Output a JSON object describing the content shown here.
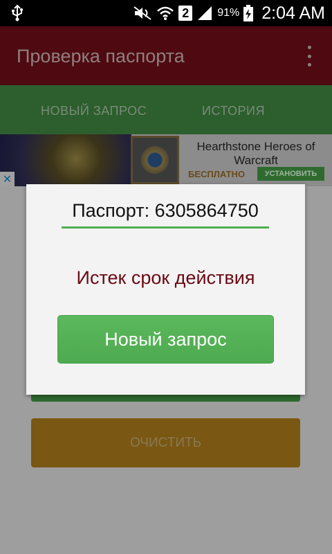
{
  "status_bar": {
    "battery_percent": "91%",
    "sim_slot": "2",
    "time": "2:04 AM"
  },
  "app_bar": {
    "title": "Проверка паспорта"
  },
  "tabs": [
    {
      "label": "НОВЫЙ ЗАПРОС"
    },
    {
      "label": "ИСТОРИЯ"
    }
  ],
  "ad": {
    "title": "Hearthstone Heroes of Warcraft",
    "price": "БЕСПЛАТНО",
    "install_label": "УСТАНОВИТЬ",
    "close_symbol": "✕"
  },
  "background_buttons": {
    "clear_label": "ОЧИСТИТЬ"
  },
  "dialog": {
    "passport_label": "Паспорт: 6305864750",
    "result_text": "Истек срок действия",
    "new_request_label": "Новый запрос"
  },
  "colors": {
    "app_bar": "#4e0a10",
    "tabs": "#2d5e2d",
    "accent_green": "#4caf50",
    "result_text": "#6a0a14",
    "clear_button": "#7a5712"
  }
}
